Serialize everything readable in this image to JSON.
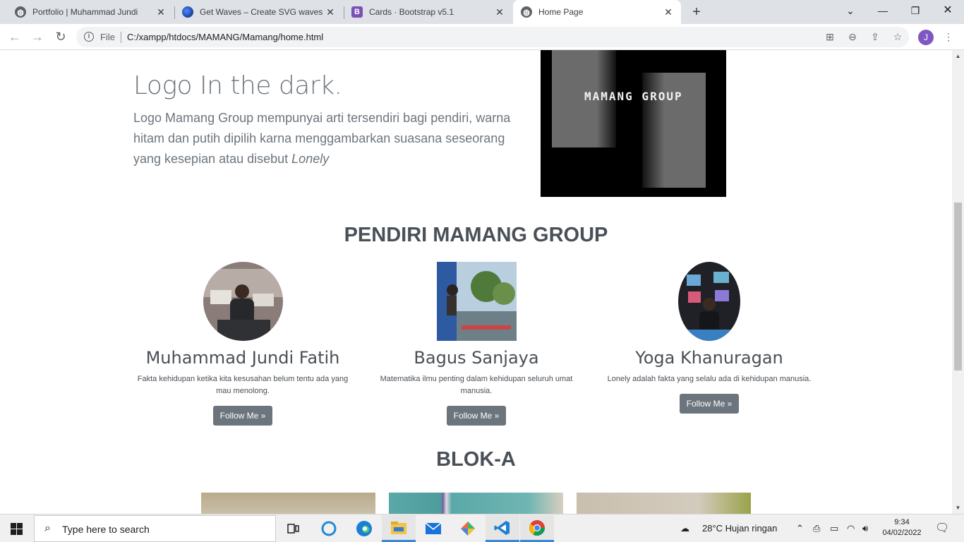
{
  "browser": {
    "tabs": [
      {
        "title": "Portfolio | Muhammad Jundi",
        "favicon": "globe-icon"
      },
      {
        "title": "Get Waves – Create SVG waves for",
        "favicon": "getwaves-icon"
      },
      {
        "title": "Cards · Bootstrap v5.1",
        "favicon": "bootstrap-icon"
      },
      {
        "title": "Home Page",
        "favicon": "globe-icon",
        "active": true
      }
    ],
    "address": {
      "scheme_label": "File",
      "url": "C:/xampp/htdocs/MAMANG/Mamang/home.html"
    },
    "profile_initial": "J"
  },
  "page": {
    "logo_section": {
      "title": "Logo In the dark.",
      "description": "Logo Mamang Group mempunyai arti tersendiri bagi pendiri, warna hitam dan putih dipilih karna menggambarkan suasana seseorang yang kesepian atau disebut ",
      "description_italic": "Lonely",
      "image_text": "MAMANG GROUP"
    },
    "founders_title": "PENDIRI MAMANG GROUP",
    "founders": [
      {
        "name": "Muhammad Jundi Fatih",
        "desc": "Fakta kehidupan ketika kita kesusahan belum tentu ada yang mau menolong.",
        "button": "Follow Me »"
      },
      {
        "name": "Bagus Sanjaya",
        "desc": "Matematika ilmu penting dalam kehidupan seluruh umat manusia.",
        "button": "Follow Me »"
      },
      {
        "name": "Yoga Khanuragan",
        "desc": "Lonely adalah fakta yang selalu ada di kehidupan manusia.",
        "button": "Follow Me »"
      }
    ],
    "blok_title": "BLOK-A"
  },
  "taskbar": {
    "search_placeholder": "Type here to search",
    "weather": "28°C  Hujan ringan",
    "time": "9:34",
    "date": "04/02/2022"
  }
}
